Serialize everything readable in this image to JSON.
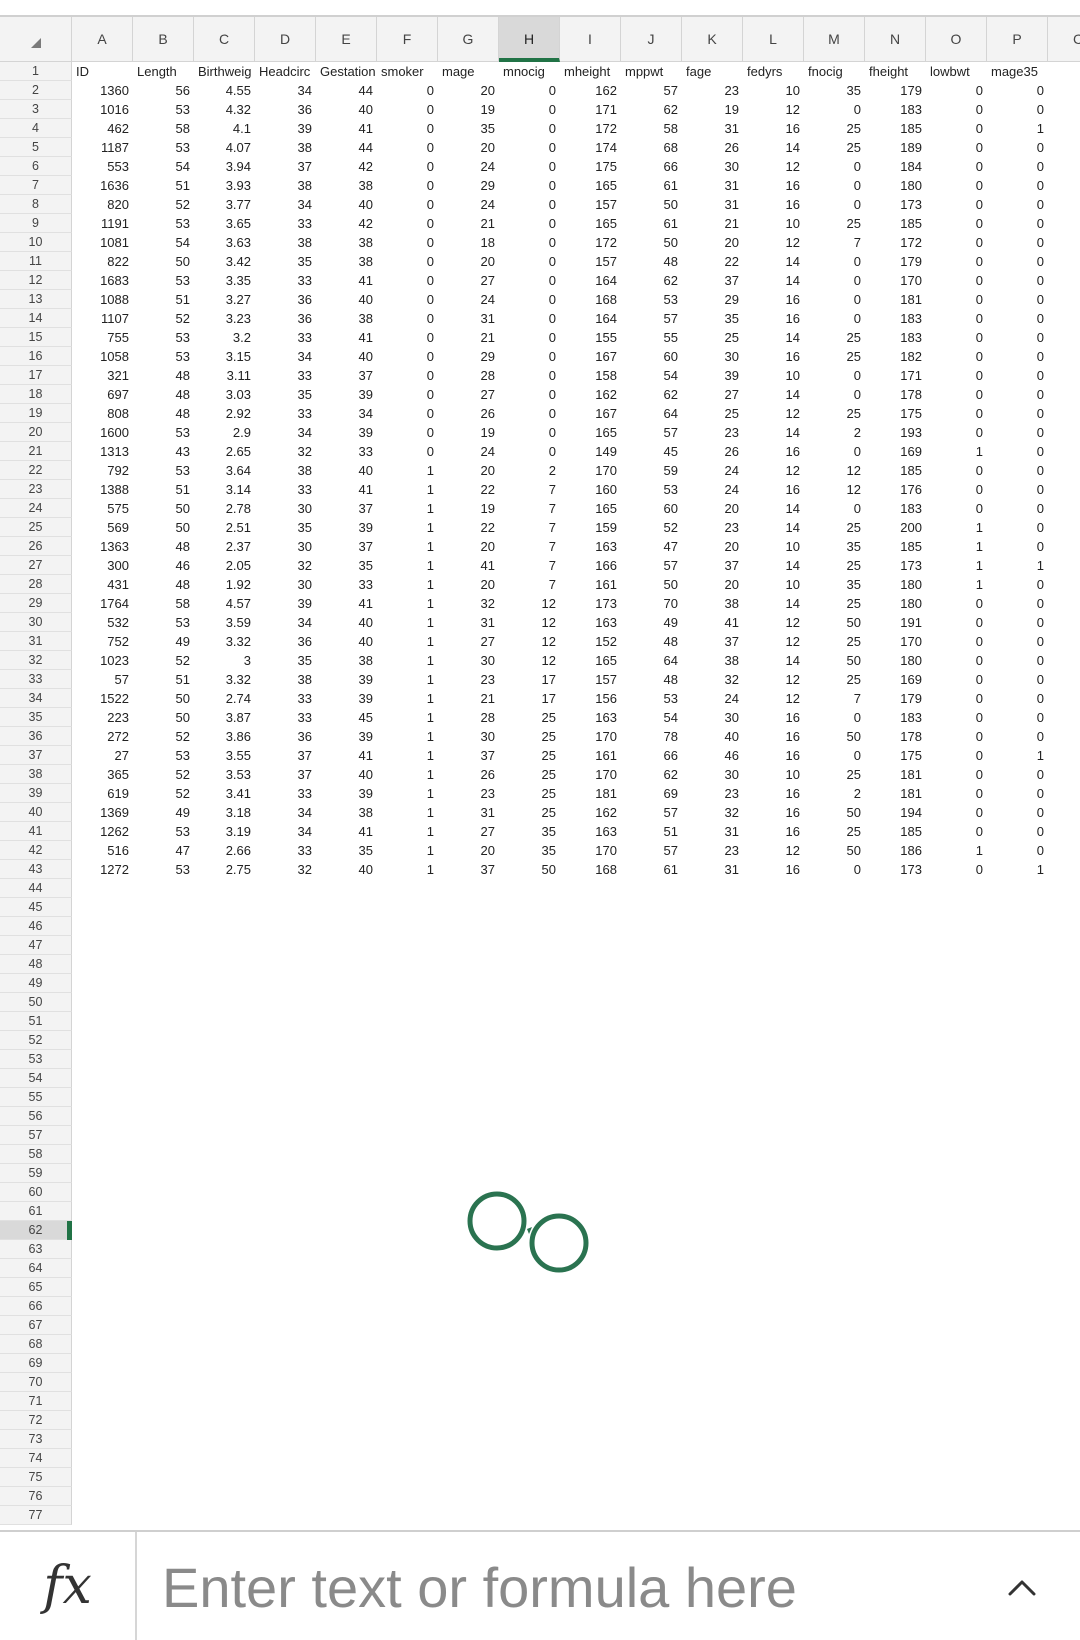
{
  "columns": [
    "A",
    "B",
    "C",
    "D",
    "E",
    "F",
    "G",
    "H",
    "I",
    "J",
    "K",
    "L",
    "M",
    "N",
    "O",
    "P",
    "Q"
  ],
  "column_labels": [
    "A",
    "B",
    "C",
    "D",
    "E",
    "F",
    "G",
    "H",
    "I",
    "J",
    "K",
    "L",
    "M",
    "N",
    "O",
    "P",
    "C"
  ],
  "selected_column": "H",
  "selected_row": 62,
  "row_count": 77,
  "headers": [
    "ID",
    "Length",
    "Birthweig",
    "Headcirc",
    "Gestation",
    "smoker",
    "mage",
    "mnocig",
    "mheight",
    "mppwt",
    "fage",
    "fedyrs",
    "fnocig",
    "fheight",
    "lowbwt",
    "mage35"
  ],
  "rows": [
    [
      "1360",
      "56",
      "4.55",
      "34",
      "44",
      "0",
      "20",
      "0",
      "162",
      "57",
      "23",
      "10",
      "35",
      "179",
      "0",
      "0"
    ],
    [
      "1016",
      "53",
      "4.32",
      "36",
      "40",
      "0",
      "19",
      "0",
      "171",
      "62",
      "19",
      "12",
      "0",
      "183",
      "0",
      "0"
    ],
    [
      "462",
      "58",
      "4.1",
      "39",
      "41",
      "0",
      "35",
      "0",
      "172",
      "58",
      "31",
      "16",
      "25",
      "185",
      "0",
      "1"
    ],
    [
      "1187",
      "53",
      "4.07",
      "38",
      "44",
      "0",
      "20",
      "0",
      "174",
      "68",
      "26",
      "14",
      "25",
      "189",
      "0",
      "0"
    ],
    [
      "553",
      "54",
      "3.94",
      "37",
      "42",
      "0",
      "24",
      "0",
      "175",
      "66",
      "30",
      "12",
      "0",
      "184",
      "0",
      "0"
    ],
    [
      "1636",
      "51",
      "3.93",
      "38",
      "38",
      "0",
      "29",
      "0",
      "165",
      "61",
      "31",
      "16",
      "0",
      "180",
      "0",
      "0"
    ],
    [
      "820",
      "52",
      "3.77",
      "34",
      "40",
      "0",
      "24",
      "0",
      "157",
      "50",
      "31",
      "16",
      "0",
      "173",
      "0",
      "0"
    ],
    [
      "1191",
      "53",
      "3.65",
      "33",
      "42",
      "0",
      "21",
      "0",
      "165",
      "61",
      "21",
      "10",
      "25",
      "185",
      "0",
      "0"
    ],
    [
      "1081",
      "54",
      "3.63",
      "38",
      "38",
      "0",
      "18",
      "0",
      "172",
      "50",
      "20",
      "12",
      "7",
      "172",
      "0",
      "0"
    ],
    [
      "822",
      "50",
      "3.42",
      "35",
      "38",
      "0",
      "20",
      "0",
      "157",
      "48",
      "22",
      "14",
      "0",
      "179",
      "0",
      "0"
    ],
    [
      "1683",
      "53",
      "3.35",
      "33",
      "41",
      "0",
      "27",
      "0",
      "164",
      "62",
      "37",
      "14",
      "0",
      "170",
      "0",
      "0"
    ],
    [
      "1088",
      "51",
      "3.27",
      "36",
      "40",
      "0",
      "24",
      "0",
      "168",
      "53",
      "29",
      "16",
      "0",
      "181",
      "0",
      "0"
    ],
    [
      "1107",
      "52",
      "3.23",
      "36",
      "38",
      "0",
      "31",
      "0",
      "164",
      "57",
      "35",
      "16",
      "0",
      "183",
      "0",
      "0"
    ],
    [
      "755",
      "53",
      "3.2",
      "33",
      "41",
      "0",
      "21",
      "0",
      "155",
      "55",
      "25",
      "14",
      "25",
      "183",
      "0",
      "0"
    ],
    [
      "1058",
      "53",
      "3.15",
      "34",
      "40",
      "0",
      "29",
      "0",
      "167",
      "60",
      "30",
      "16",
      "25",
      "182",
      "0",
      "0"
    ],
    [
      "321",
      "48",
      "3.11",
      "33",
      "37",
      "0",
      "28",
      "0",
      "158",
      "54",
      "39",
      "10",
      "0",
      "171",
      "0",
      "0"
    ],
    [
      "697",
      "48",
      "3.03",
      "35",
      "39",
      "0",
      "27",
      "0",
      "162",
      "62",
      "27",
      "14",
      "0",
      "178",
      "0",
      "0"
    ],
    [
      "808",
      "48",
      "2.92",
      "33",
      "34",
      "0",
      "26",
      "0",
      "167",
      "64",
      "25",
      "12",
      "25",
      "175",
      "0",
      "0"
    ],
    [
      "1600",
      "53",
      "2.9",
      "34",
      "39",
      "0",
      "19",
      "0",
      "165",
      "57",
      "23",
      "14",
      "2",
      "193",
      "0",
      "0"
    ],
    [
      "1313",
      "43",
      "2.65",
      "32",
      "33",
      "0",
      "24",
      "0",
      "149",
      "45",
      "26",
      "16",
      "0",
      "169",
      "1",
      "0"
    ],
    [
      "792",
      "53",
      "3.64",
      "38",
      "40",
      "1",
      "20",
      "2",
      "170",
      "59",
      "24",
      "12",
      "12",
      "185",
      "0",
      "0"
    ],
    [
      "1388",
      "51",
      "3.14",
      "33",
      "41",
      "1",
      "22",
      "7",
      "160",
      "53",
      "24",
      "16",
      "12",
      "176",
      "0",
      "0"
    ],
    [
      "575",
      "50",
      "2.78",
      "30",
      "37",
      "1",
      "19",
      "7",
      "165",
      "60",
      "20",
      "14",
      "0",
      "183",
      "0",
      "0"
    ],
    [
      "569",
      "50",
      "2.51",
      "35",
      "39",
      "1",
      "22",
      "7",
      "159",
      "52",
      "23",
      "14",
      "25",
      "200",
      "1",
      "0"
    ],
    [
      "1363",
      "48",
      "2.37",
      "30",
      "37",
      "1",
      "20",
      "7",
      "163",
      "47",
      "20",
      "10",
      "35",
      "185",
      "1",
      "0"
    ],
    [
      "300",
      "46",
      "2.05",
      "32",
      "35",
      "1",
      "41",
      "7",
      "166",
      "57",
      "37",
      "14",
      "25",
      "173",
      "1",
      "1"
    ],
    [
      "431",
      "48",
      "1.92",
      "30",
      "33",
      "1",
      "20",
      "7",
      "161",
      "50",
      "20",
      "10",
      "35",
      "180",
      "1",
      "0"
    ],
    [
      "1764",
      "58",
      "4.57",
      "39",
      "41",
      "1",
      "32",
      "12",
      "173",
      "70",
      "38",
      "14",
      "25",
      "180",
      "0",
      "0"
    ],
    [
      "532",
      "53",
      "3.59",
      "34",
      "40",
      "1",
      "31",
      "12",
      "163",
      "49",
      "41",
      "12",
      "50",
      "191",
      "0",
      "0"
    ],
    [
      "752",
      "49",
      "3.32",
      "36",
      "40",
      "1",
      "27",
      "12",
      "152",
      "48",
      "37",
      "12",
      "25",
      "170",
      "0",
      "0"
    ],
    [
      "1023",
      "52",
      "3",
      "35",
      "38",
      "1",
      "30",
      "12",
      "165",
      "64",
      "38",
      "14",
      "50",
      "180",
      "0",
      "0"
    ],
    [
      "57",
      "51",
      "3.32",
      "38",
      "39",
      "1",
      "23",
      "17",
      "157",
      "48",
      "32",
      "12",
      "25",
      "169",
      "0",
      "0"
    ],
    [
      "1522",
      "50",
      "2.74",
      "33",
      "39",
      "1",
      "21",
      "17",
      "156",
      "53",
      "24",
      "12",
      "7",
      "179",
      "0",
      "0"
    ],
    [
      "223",
      "50",
      "3.87",
      "33",
      "45",
      "1",
      "28",
      "25",
      "163",
      "54",
      "30",
      "16",
      "0",
      "183",
      "0",
      "0"
    ],
    [
      "272",
      "52",
      "3.86",
      "36",
      "39",
      "1",
      "30",
      "25",
      "170",
      "78",
      "40",
      "16",
      "50",
      "178",
      "0",
      "0"
    ],
    [
      "27",
      "53",
      "3.55",
      "37",
      "41",
      "1",
      "37",
      "25",
      "161",
      "66",
      "46",
      "16",
      "0",
      "175",
      "0",
      "1"
    ],
    [
      "365",
      "52",
      "3.53",
      "37",
      "40",
      "1",
      "26",
      "25",
      "170",
      "62",
      "30",
      "10",
      "25",
      "181",
      "0",
      "0"
    ],
    [
      "619",
      "52",
      "3.41",
      "33",
      "39",
      "1",
      "23",
      "25",
      "181",
      "69",
      "23",
      "16",
      "2",
      "181",
      "0",
      "0"
    ],
    [
      "1369",
      "49",
      "3.18",
      "34",
      "38",
      "1",
      "31",
      "25",
      "162",
      "57",
      "32",
      "16",
      "50",
      "194",
      "0",
      "0"
    ],
    [
      "1262",
      "53",
      "3.19",
      "34",
      "41",
      "1",
      "27",
      "35",
      "163",
      "51",
      "31",
      "16",
      "25",
      "185",
      "0",
      "0"
    ],
    [
      "516",
      "47",
      "2.66",
      "33",
      "35",
      "1",
      "20",
      "35",
      "170",
      "57",
      "23",
      "12",
      "50",
      "186",
      "1",
      "0"
    ],
    [
      "1272",
      "53",
      "2.75",
      "32",
      "40",
      "1",
      "37",
      "50",
      "168",
      "61",
      "31",
      "16",
      "0",
      "173",
      "0",
      "1"
    ]
  ],
  "formula_bar": {
    "fx_label": "fx",
    "placeholder": "Enter text or formula here"
  },
  "icons": {
    "corner": "select-all-triangle-icon",
    "loading": "loading-spinner-icon",
    "expand": "chevron-up-icon"
  },
  "colors": {
    "accent": "#217346",
    "header_bg": "#f3f3f3",
    "selected_header_bg": "#d9d9d9",
    "spinner": "#2a7350"
  }
}
